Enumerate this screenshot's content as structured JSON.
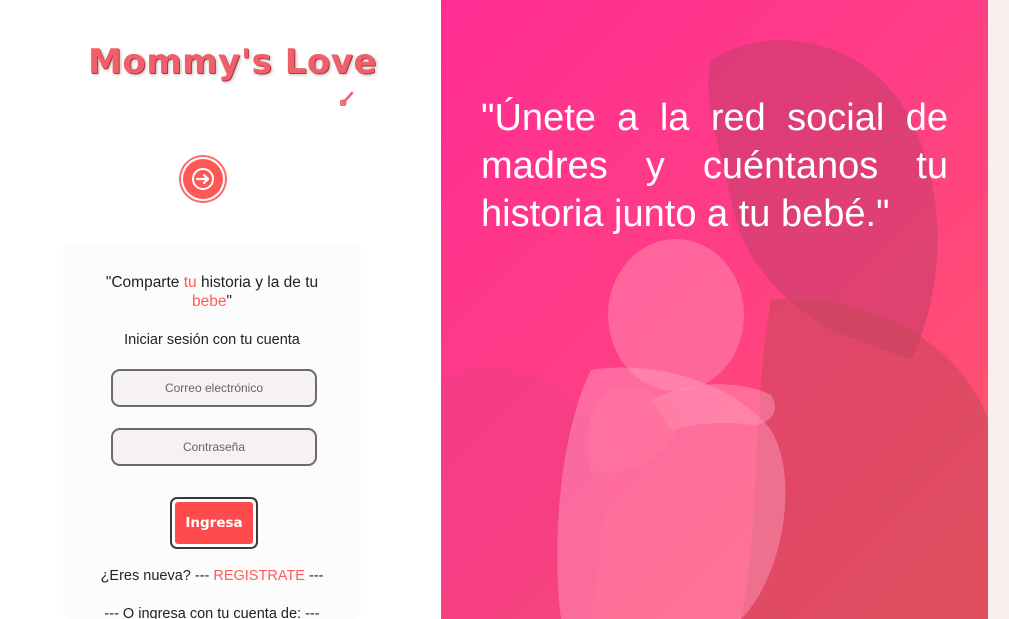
{
  "brand": {
    "name": "Mommy's Love"
  },
  "login": {
    "tagline_start": "\"Comparte ",
    "tagline_accent1": "tu",
    "tagline_middle": " historia y la de tu ",
    "tagline_accent2": "bebe",
    "tagline_end": "\"",
    "signin_text": "Iniciar sesión con tu cuenta",
    "email_placeholder": "Correo electrónico",
    "password_placeholder": "Contraseña",
    "submit_label": "Ingresa",
    "register_prefix": "¿Eres nueva? ---",
    "register_link": "REGISTRATE",
    "register_suffix": "---",
    "social_text": "--- O ingresa con tu cuenta de: ---"
  },
  "hero": {
    "quote": "\"Únete a la red social de madres y cuéntanos tu historia junto a tu bebé.\""
  },
  "icons": {
    "login": "arrow-right-circle-icon",
    "logo_rattle": "rattle-icon",
    "hero_photo": "mother-and-baby-photo"
  },
  "colors": {
    "accent": "#ff5a5a",
    "button": "#ff4b4b",
    "hero_gradient_start": "#ff2d93",
    "hero_gradient_end": "#ff5a66"
  }
}
